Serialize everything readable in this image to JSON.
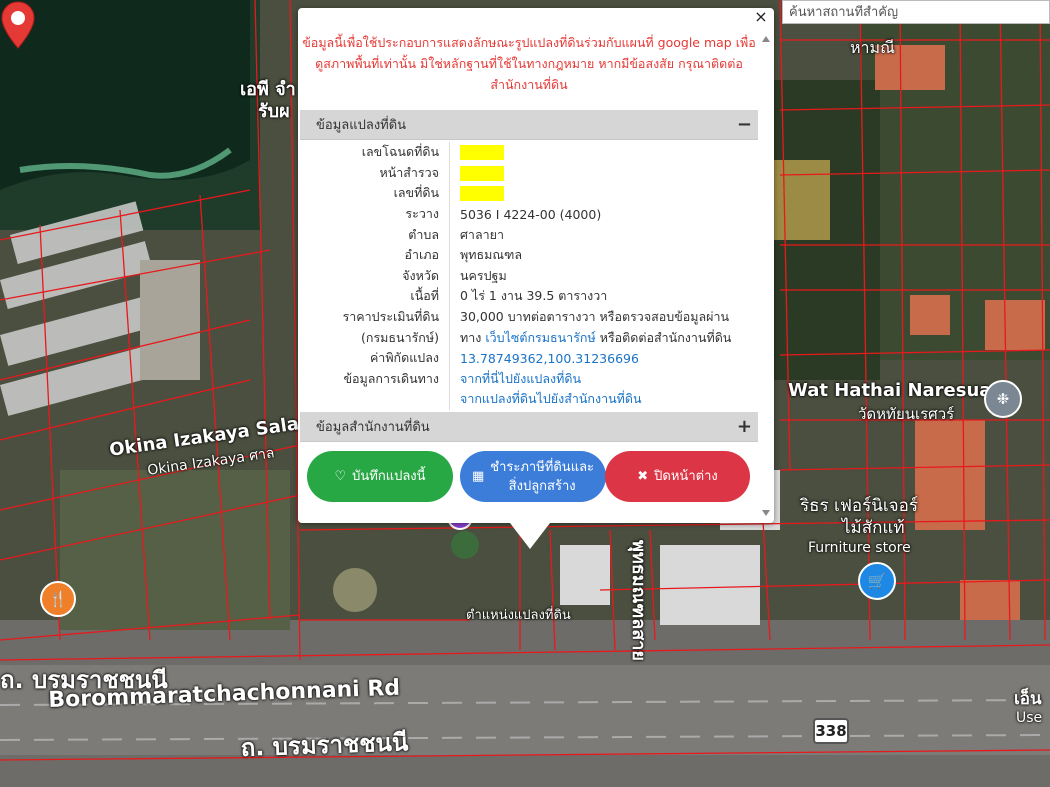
{
  "search": {
    "placeholder": "ค้นหาสถานที่สำคัญ"
  },
  "popup": {
    "close_symbol": "×",
    "notice": "ข้อมูลนี้เพื่อใช้ประกอบการแสดงลักษณะรูปแปลงที่ดินร่วมกับแผนที่ google map เพื่อดูสภาพพื้นที่เท่านั้น มิใช่หลักฐานที่ใช้ในทางกฎหมาย หากมีข้อสงสัย กรุณาติดต่อสำนักงานที่ดิน",
    "parcel_section": {
      "title": "ข้อมูลแปลงที่ดิน",
      "toggle": "−"
    },
    "office_section": {
      "title": "ข้อมูลสำนักงานที่ดิน",
      "toggle": "+"
    },
    "rows": {
      "deed_no": {
        "label": "เลขโฉนดที่ดิน"
      },
      "survey_page": {
        "label": "หน้าสำรวจ"
      },
      "land_no": {
        "label": "เลขที่ดิน"
      },
      "sheet": {
        "label": "ระวาง",
        "value": "5036 I 4224-00 (4000)"
      },
      "subdistrict": {
        "label": "ตำบล",
        "value": "ศาลายา"
      },
      "district": {
        "label": "อำเภอ",
        "value": "พุทธมณฑล"
      },
      "province": {
        "label": "จังหวัด",
        "value": "นครปฐม"
      },
      "area": {
        "label": "เนื้อที่",
        "value": "0 ไร่ 1 งาน 39.5 ตารางวา"
      },
      "price": {
        "label": "ราคาประเมินที่ดิน",
        "value": "30,000 บาทต่อตารางวา หรือตรวจสอบข้อมูลผ่าน"
      },
      "price2": {
        "label": "(กรมธนารักษ์)",
        "prefix": "ทาง",
        "link": "เว็บไซต์กรมธนารักษ์",
        "suffix": "หรือติดต่อสำนักงานที่ดิน"
      },
      "coords": {
        "label": "ค่าพิกัดแปลง",
        "value": "13.78749362,100.31236696"
      },
      "travel": {
        "label": "ข้อมูลการเดินทาง",
        "link1": "จากที่นี่ไปยังแปลงที่ดิน",
        "link2": "จากแปลงที่ดินไปยังสำนักงานที่ดิน"
      }
    },
    "buttons": {
      "save": "บันทึกแปลงนี้",
      "tax_line1": "ชำระภาษีที่ดินและ",
      "tax_line2": "สิ่งปลูกสร้าง",
      "close": "ปิดหน้าต่าง"
    }
  },
  "map": {
    "road_th": "ถ. บรมราชชนนี",
    "road_en": "Borommaratchachonnani Rd",
    "road_th2": "ถ. บรมราชชนนี",
    "route_number": "338",
    "wat_en": "Wat Hathai Naresuan",
    "wat_th": "วัดหทัยนเรศวร์",
    "okina_en": "Okina Izakaya Sala",
    "okina_th": "Okina Izakaya ศาล",
    "furniture_th1": "ริธร เฟอร์นิเจอร์",
    "furniture_th2": "ไม้สักแท้",
    "furniture_en": "Furniture store",
    "parcel_label": "ตำแหน่งแปลงที่ดิน",
    "side_road": "พุทธมณฑลสาย",
    "right_label1": "เอ็น",
    "right_label2": "Use",
    "top_left1": "เอพี จำ",
    "top_left2": "รับผ",
    "top_right": "หามณี"
  },
  "colors": {
    "parcel_line": "#e8191c",
    "marker": "#e53935",
    "save": "#28a745",
    "tax": "#3b7dd8",
    "close": "#dc3545",
    "notice": "#e53935"
  }
}
